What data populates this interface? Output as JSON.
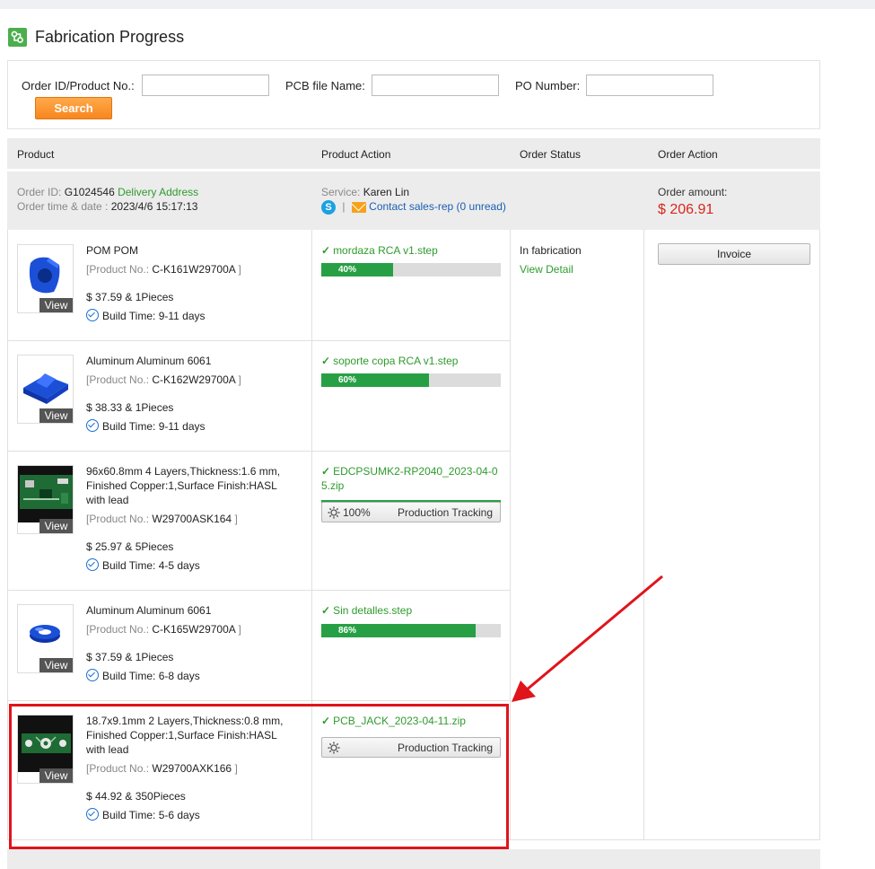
{
  "page": {
    "title": "Fabrication Progress"
  },
  "search": {
    "order_label": "Order ID/Product No.:",
    "order_value": "",
    "pcb_label": "PCB file Name:",
    "pcb_value": "",
    "po_label": "PO Number:",
    "po_value": "",
    "button_label": "Search"
  },
  "table": {
    "headers": [
      "Product",
      "Product Action",
      "Order Status",
      "Order Action"
    ]
  },
  "order": {
    "id_label": "Order ID:",
    "id": "G1024546",
    "delivery_link": "Delivery Address",
    "time_label": "Order time & date :",
    "time": "2023/4/6 15:17:13",
    "service_label": "Service:",
    "service_name": "Karen Lin",
    "separator": "|",
    "contact_link": "Contact sales-rep (0 unread)",
    "amount_label": "Order amount:",
    "amount": "$ 206.91",
    "status": "In fabrication",
    "status_link": "View Detail",
    "invoice_label": "Invoice"
  },
  "common": {
    "view_label": "View",
    "product_no_prefix": "[Product No.:",
    "product_no_suffix": "]",
    "build_prefix": "Build Time:",
    "tracking_label": "Production Tracking"
  },
  "products": [
    {
      "name": "POM POM",
      "product_no": "C-K161W29700A",
      "price": "$ 37.59 & 1Pieces",
      "build_time": "9-11 days",
      "file": "mordaza RCA v1.step",
      "progress": 40,
      "progress_label": "40%"
    },
    {
      "name": "Aluminum Aluminum 6061",
      "product_no": "C-K162W29700A",
      "price": "$ 38.33 & 1Pieces",
      "build_time": "9-11 days",
      "file": "soporte copa RCA v1.step",
      "progress": 60,
      "progress_label": "60%"
    },
    {
      "name": "96x60.8mm 4 Layers,Thickness:1.6 mm, Finished Copper:1,Surface Finish:HASL with lead",
      "product_no": "W29700ASK164",
      "price": "$ 25.97 & 5Pieces",
      "build_time": "4-5 days",
      "file": "EDCPSUMK2-RP2040_2023-04-05.zip",
      "progress": 100,
      "progress_label": "100%"
    },
    {
      "name": "Aluminum Aluminum 6061",
      "product_no": "C-K165W29700A",
      "price": "$ 37.59 & 1Pieces",
      "build_time": "6-8 days",
      "file": "Sin detalles.step",
      "progress": 86,
      "progress_label": "86%"
    },
    {
      "name": "18.7x9.1mm 2 Layers,Thickness:0.8 mm, Finished Copper:1,Surface Finish:HASL with lead",
      "product_no": "W29700AXK166",
      "price": "$ 44.92 & 350Pieces",
      "build_time": "5-6 days",
      "file": "PCB_JACK_2023-04-11.zip",
      "progress": 0,
      "progress_label": ""
    }
  ],
  "colors": {
    "accent_green": "#27a045",
    "link_green": "#2e9b2e",
    "link_blue": "#1a5fb4",
    "price_red": "#d9261c",
    "button_orange": "#f7861f",
    "annotation_red": "#e0141b"
  }
}
